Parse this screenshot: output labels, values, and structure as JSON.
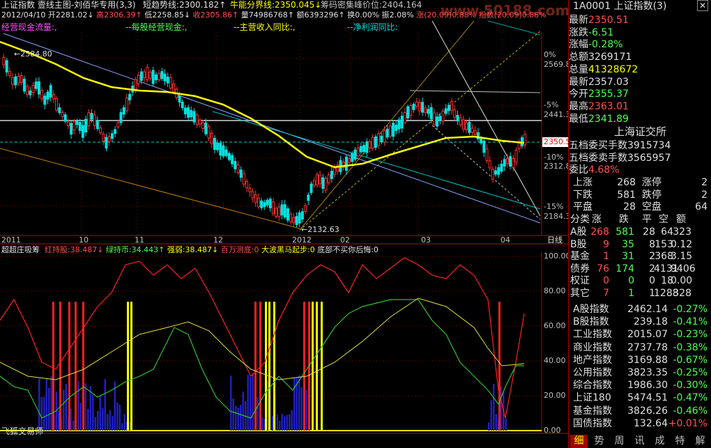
{
  "window": {
    "title_left": "上证指数  壹线主图-刘佰华专用(3,3)",
    "short_trend": "短趋势线:2300.182↑",
    "bull_line": "牛能分界线:2350.045↓",
    "chip_peak": "筹码密集峰价位:2404.164",
    "watermark": "www.50188.com"
  },
  "header2": {
    "date": "2012/04/10",
    "open": "开2281.02↓",
    "high": "高2306.39↑",
    "low": "低2258.85↓",
    "close": "收2305.86↑",
    "volume": "量74986768↑",
    "amount": "额6393296↑",
    "turnover": "换0.00%",
    "amplitude": "振2.08%",
    "change": "涨(20.09)0.88%",
    "index": "指数(20.09)0.88%"
  },
  "header3": {
    "a": "经营现金流量:,",
    "b": "--每股经营现金:,",
    "c": "--主营收入同比:,",
    "d": "--净利润同比:"
  },
  "price_axis": [
    {
      "label": "0%",
      "color": "#c0c0c0"
    },
    {
      "label": "2569.8",
      "color": "#c0c0c0"
    },
    {
      "label": "-5%",
      "color": "#c0c0c0"
    },
    {
      "label": "2441.3",
      "color": "#c0c0c0"
    },
    {
      "label": "2350.5",
      "color": "#ff5050"
    },
    {
      "label": "-10%",
      "color": "#c0c0c0"
    },
    {
      "label": "2312.8",
      "color": "#c0c0c0"
    },
    {
      "label": "-15%",
      "color": "#c0c0c0"
    },
    {
      "label": "2184.3",
      "color": "#c0c0c0"
    }
  ],
  "annotations": {
    "high_point": "2584.80",
    "low_point": "2132.63"
  },
  "date_axis": [
    "2011",
    "10",
    "11",
    "12",
    "2012",
    "02",
    "03",
    "04",
    "日线"
  ],
  "indicator": {
    "name": "超超庄吸筹",
    "red_hold": "红持股:38.487↓",
    "green_hold": "绿持币:34.443↑",
    "strength": "强弱:38.487↓",
    "million_bottom": "百万测底:0",
    "big_dark_horse": "大波黑马起步:0",
    "bottom_buy": "底部不买你后悔:0",
    "axis": [
      "100.00",
      "80.00",
      "60.00",
      "40.00",
      "20.00",
      "0.00"
    ],
    "footer": "飞狐交易师"
  },
  "panel": {
    "code_title": "1A0001  上证指数(3)",
    "quote": [
      {
        "k": "最新",
        "v": "2350.51",
        "vc": "#ff5050"
      },
      {
        "k": "涨跌",
        "v": "-6.51",
        "vc": "#50ff50"
      },
      {
        "k": "涨幅",
        "v": "-0.28%",
        "vc": "#50ff50"
      },
      {
        "k": "总额",
        "v": "3269171",
        "vc": "#e0e0e0"
      },
      {
        "k": "总量",
        "v": "41328672",
        "vc": "#ffff00"
      },
      {
        "k": "最新",
        "v": "2357.03",
        "vc": "#e0e0e0"
      },
      {
        "k": "今开",
        "v": "2355.37",
        "vc": "#50ff50"
      },
      {
        "k": "最高",
        "v": "2363.01",
        "vc": "#ff5050"
      },
      {
        "k": "最低",
        "v": "2341.89",
        "vc": "#50ff50"
      }
    ],
    "exchange": "上海证交所",
    "orders": [
      {
        "k": "五档委买手数",
        "v": "3915734",
        "vc": "#e0e0e0"
      },
      {
        "k": "五档委卖手数",
        "v": "3565957",
        "vc": "#e0e0e0"
      },
      {
        "k": "委比",
        "v": "4.68%",
        "vc": "#ff5050"
      }
    ],
    "breadth": [
      {
        "a": "上涨",
        "av": "268",
        "b": "涨停",
        "bv": "2"
      },
      {
        "a": "下跌",
        "av": "581",
        "b": "跌停",
        "bv": "2"
      },
      {
        "a": "平盘",
        "av": "28",
        "b": "空盘",
        "bv": "64"
      }
    ],
    "market_header": [
      "分类",
      "涨",
      "跌",
      "平",
      "空",
      "额"
    ],
    "markets": [
      {
        "n": "A股",
        "c": [
          "268",
          "581",
          "28",
          "64",
          "323"
        ]
      },
      {
        "n": "B股",
        "c": [
          "9",
          "35",
          "8",
          "153",
          "0.12"
        ]
      },
      {
        "n": "基金",
        "c": [
          "1",
          "31",
          "2",
          "368",
          "3.15"
        ]
      },
      {
        "n": "债券",
        "c": [
          "76",
          "174",
          "2",
          "4131",
          "9406"
        ]
      },
      {
        "n": "权证",
        "c": [
          "0",
          "0",
          "0",
          "18",
          "0.00"
        ]
      },
      {
        "n": "其它",
        "c": [
          "7",
          "1",
          "1",
          "1288",
          "328"
        ]
      }
    ],
    "indices": [
      {
        "n": "A股指数",
        "v": "2462.14",
        "p": "-0.27%",
        "pc": "#50ff50"
      },
      {
        "n": "B股指数",
        "v": "239.18",
        "p": "-0.41%",
        "pc": "#50ff50"
      },
      {
        "n": "工业指数",
        "v": "2015.07",
        "p": "-0.23%",
        "pc": "#50ff50"
      },
      {
        "n": "商业指数",
        "v": "2737.78",
        "p": "-0.38%",
        "pc": "#50ff50"
      },
      {
        "n": "地产指数",
        "v": "3169.88",
        "p": "-0.67%",
        "pc": "#50ff50"
      },
      {
        "n": "公用指数",
        "v": "3823.35",
        "p": "-0.25%",
        "pc": "#50ff50"
      },
      {
        "n": "综合指数",
        "v": "1986.30",
        "p": "-0.30%",
        "pc": "#50ff50"
      },
      {
        "n": "上证180",
        "v": "5474.51",
        "p": "-0.47%",
        "pc": "#50ff50"
      },
      {
        "n": "基金指数",
        "v": "3826.26",
        "p": "-0.46%",
        "pc": "#50ff50"
      },
      {
        "n": "国债指数",
        "v": "132.64",
        "p": "+0.01%",
        "pc": "#ff5050"
      }
    ],
    "tabs": [
      "细",
      "势",
      "周",
      "讯",
      "成",
      "特",
      "解"
    ]
  },
  "colors": {
    "up": "#ff3030",
    "down": "#00e0e0",
    "ma": "#ffff00",
    "grid": "#a00000",
    "axis": "#c00000"
  }
}
